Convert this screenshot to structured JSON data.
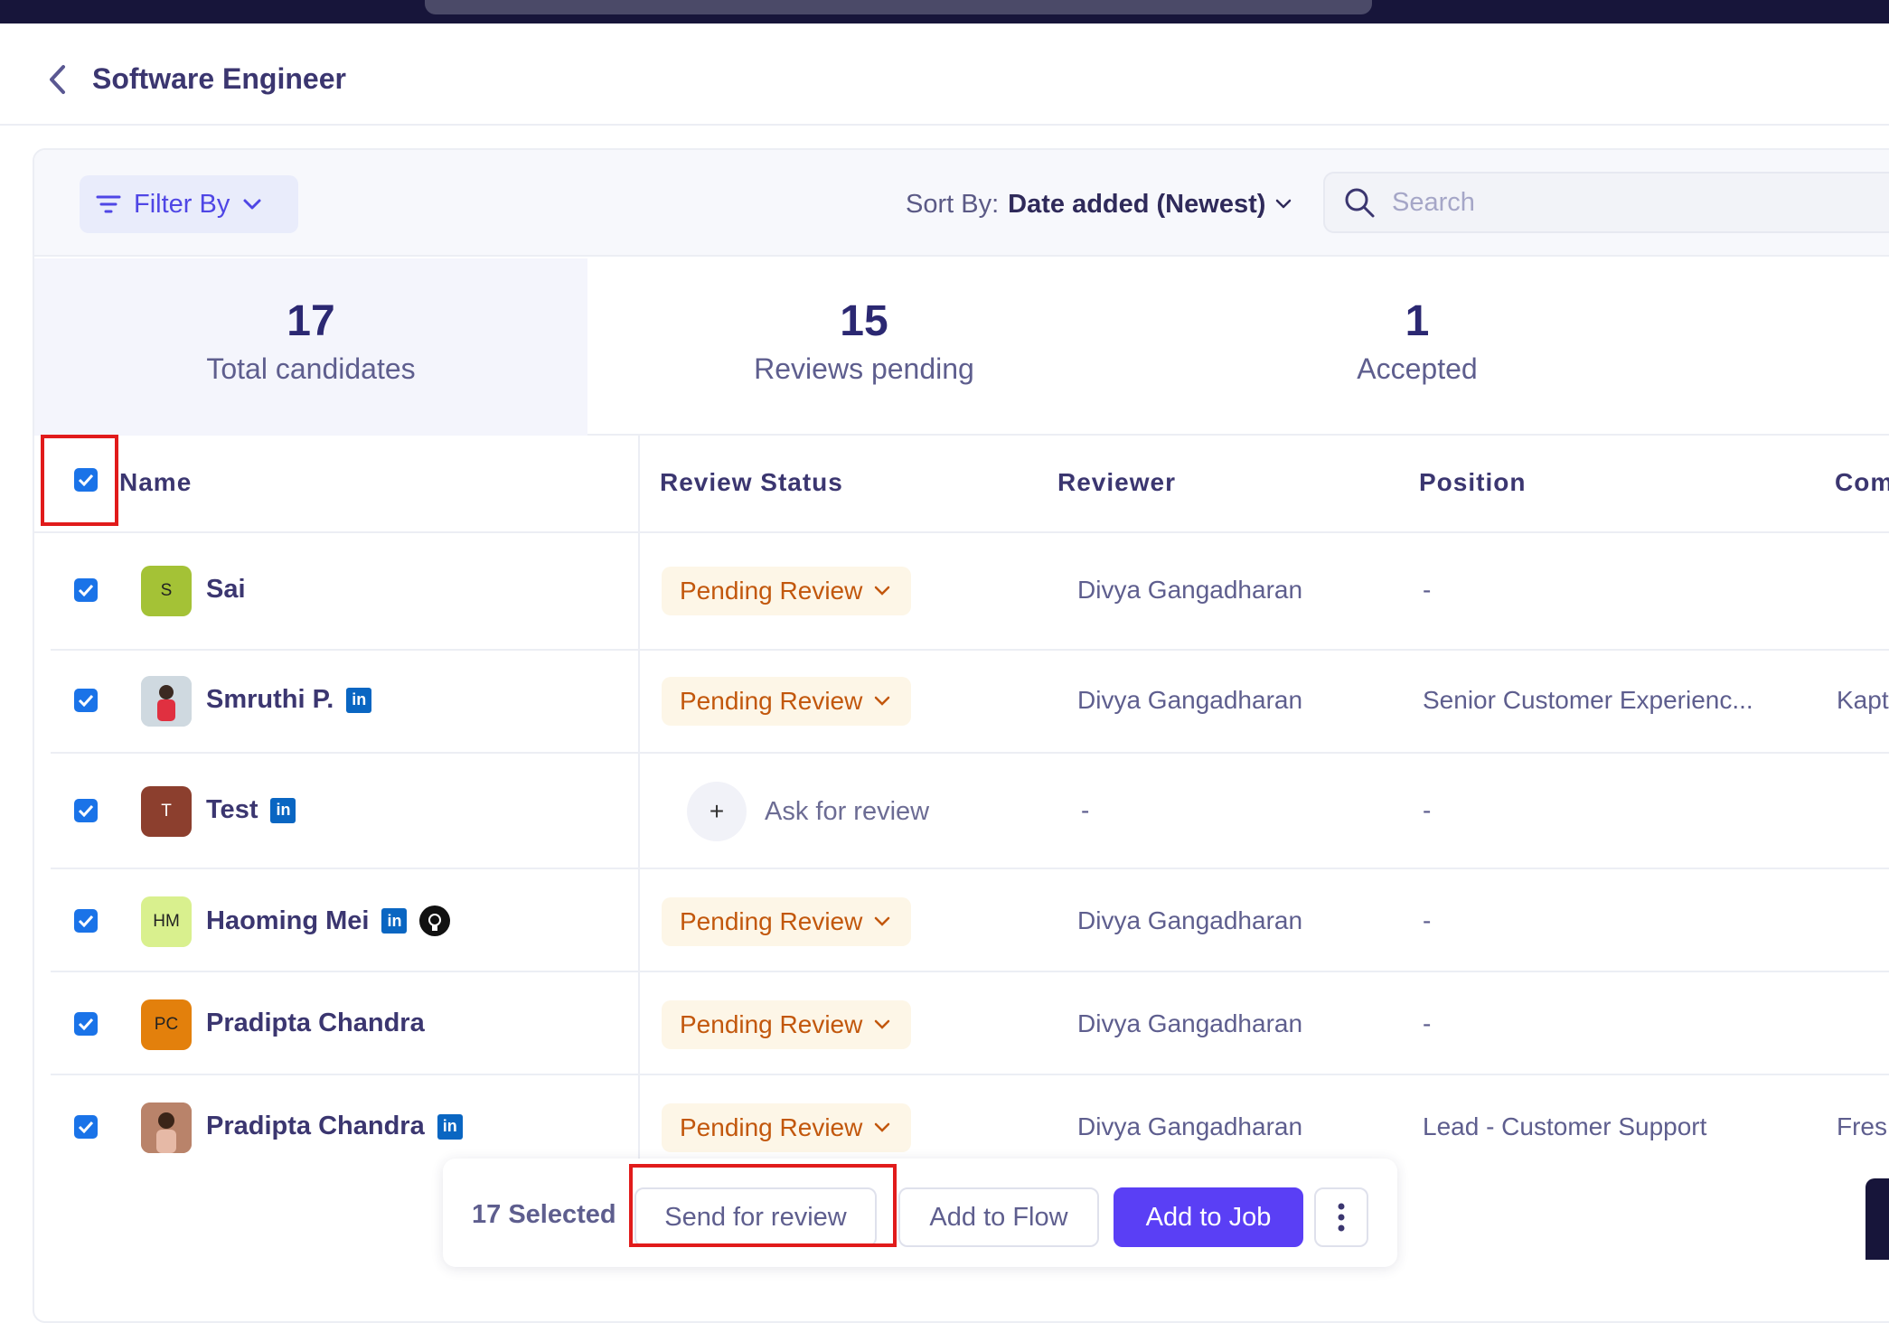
{
  "header": {
    "title": "Software Engineer"
  },
  "toolbar": {
    "filter_label": "Filter By",
    "sort_key": "Sort By:",
    "sort_value": "Date added (Newest)",
    "search_placeholder": "Search"
  },
  "stats": [
    {
      "value": "17",
      "label": "Total candidates"
    },
    {
      "value": "15",
      "label": "Reviews pending"
    },
    {
      "value": "1",
      "label": "Accepted"
    }
  ],
  "table": {
    "headers": {
      "name": "Name",
      "review_status": "Review Status",
      "reviewer": "Reviewer",
      "position": "Position",
      "company": "Com"
    },
    "rows": [
      {
        "initials": "S",
        "name": "Sai",
        "status": "Pending Review",
        "reviewer": "Divya Gangadharan",
        "position": "-",
        "company": ""
      },
      {
        "initials": "",
        "name": "Smruthi P.",
        "status": "Pending Review",
        "reviewer": "Divya Gangadharan",
        "position": "Senior Customer Experienc...",
        "company": "Kapt"
      },
      {
        "initials": "T",
        "name": "Test",
        "status": "Ask for review",
        "reviewer": "-",
        "position": "-",
        "company": ""
      },
      {
        "initials": "HM",
        "name": "Haoming Mei",
        "status": "Pending Review",
        "reviewer": "Divya Gangadharan",
        "position": "-",
        "company": ""
      },
      {
        "initials": "PC",
        "name": "Pradipta Chandra",
        "status": "Pending Review",
        "reviewer": "Divya Gangadharan",
        "position": "-",
        "company": ""
      },
      {
        "initials": "",
        "name": "Pradipta Chandra",
        "status": "Pending Review",
        "reviewer": "Divya Gangadharan",
        "position": "Lead - Customer Support",
        "company": "Fres"
      }
    ]
  },
  "actionbar": {
    "selected": "17 Selected",
    "send_review": "Send for review",
    "add_flow": "Add to Flow",
    "add_job": "Add to Job"
  },
  "icons": {
    "back": "chevron-left-icon",
    "filter": "filter-lines-icon",
    "search": "search-icon",
    "linkedin": "linkedin-icon",
    "github": "github-icon",
    "more": "more-vertical-icon"
  },
  "colors": {
    "accent": "#4f46e5",
    "primary_button": "#5a3ff5",
    "pending_text": "#c2570c",
    "pending_bg": "#fdf6e7",
    "highlight": "#e11b1b",
    "checkbox": "#1a73e8"
  }
}
